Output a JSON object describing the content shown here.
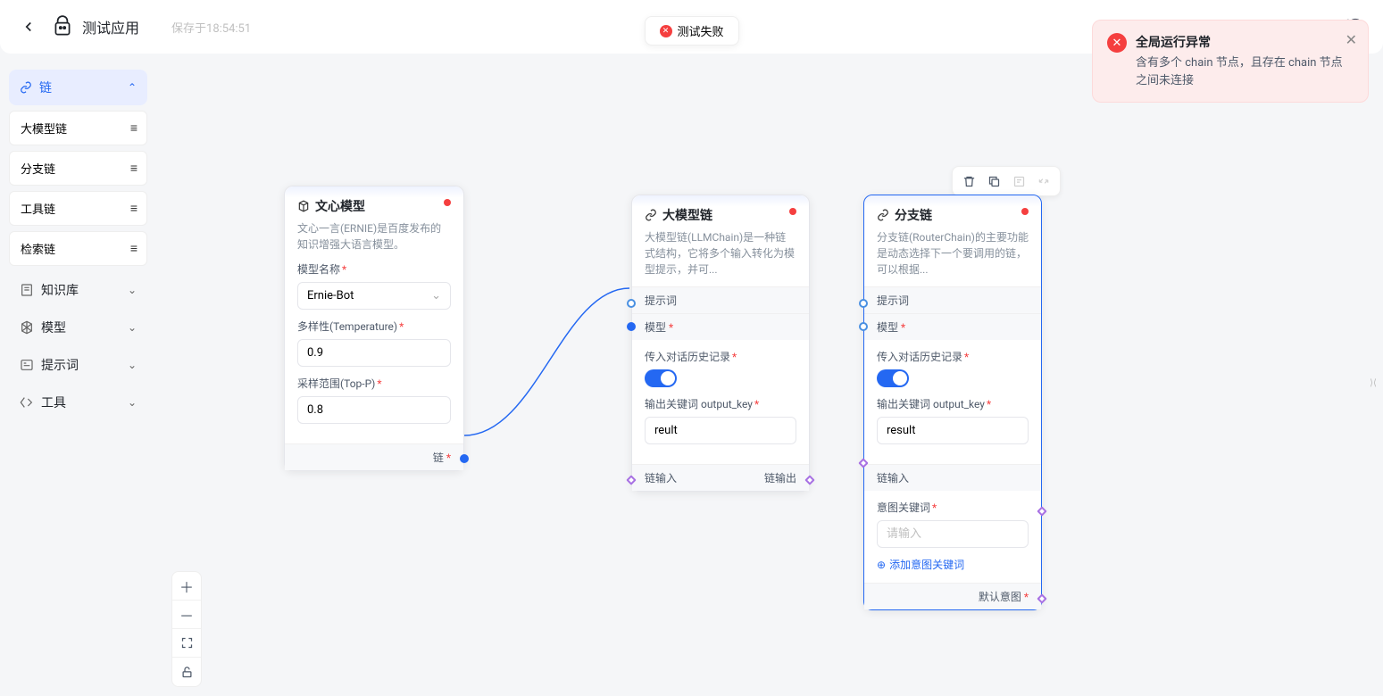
{
  "header": {
    "title": "测试应用",
    "save_time": "保存于18:54:51",
    "test_fail": "测试失败"
  },
  "error_toast": {
    "title": "全局运行异常",
    "body": "含有多个 chain 节点，且存在 chain 节点之间未连接"
  },
  "sidebar": {
    "chain_head": "链",
    "items": [
      "大模型链",
      "分支链",
      "工具链",
      "检索链"
    ],
    "cats": [
      "知识库",
      "模型",
      "提示词",
      "工具"
    ]
  },
  "node1": {
    "title": "文心模型",
    "desc": "文心一言(ERNIE)是百度发布的知识增强大语言模型。",
    "model_name_label": "模型名称",
    "model_name_value": "Ernie-Bot",
    "temp_label": "多样性(Temperature)",
    "temp_value": "0.9",
    "topp_label": "采样范围(Top-P)",
    "topp_value": "0.8",
    "out_label": "链"
  },
  "node2": {
    "title": "大模型链",
    "desc": "大模型链(LLMChain)是一种链式结构，它将多个输入转化为模型提示，并可...",
    "prompt_label": "提示词",
    "model_label": "模型",
    "history_label": "传入对话历史记录",
    "output_key_label": "输出关键词 output_key",
    "output_key_value": "reult",
    "chain_in": "链输入",
    "chain_out": "链输出"
  },
  "node3": {
    "title": "分支链",
    "desc": "分支链(RouterChain)的主要功能是动态选择下一个要调用的链，可以根据...",
    "prompt_label": "提示词",
    "model_label": "模型",
    "history_label": "传入对话历史记录",
    "output_key_label": "输出关键词 output_key",
    "output_key_value": "result",
    "chain_in": "链输入",
    "intent_label": "意图关键词",
    "intent_placeholder": "请输入",
    "add_intent": "添加意图关键词",
    "default_intent": "默认意图"
  },
  "toolbar": {
    "delete": "delete",
    "copy": "copy",
    "note": "note",
    "collapse": "collapse"
  }
}
